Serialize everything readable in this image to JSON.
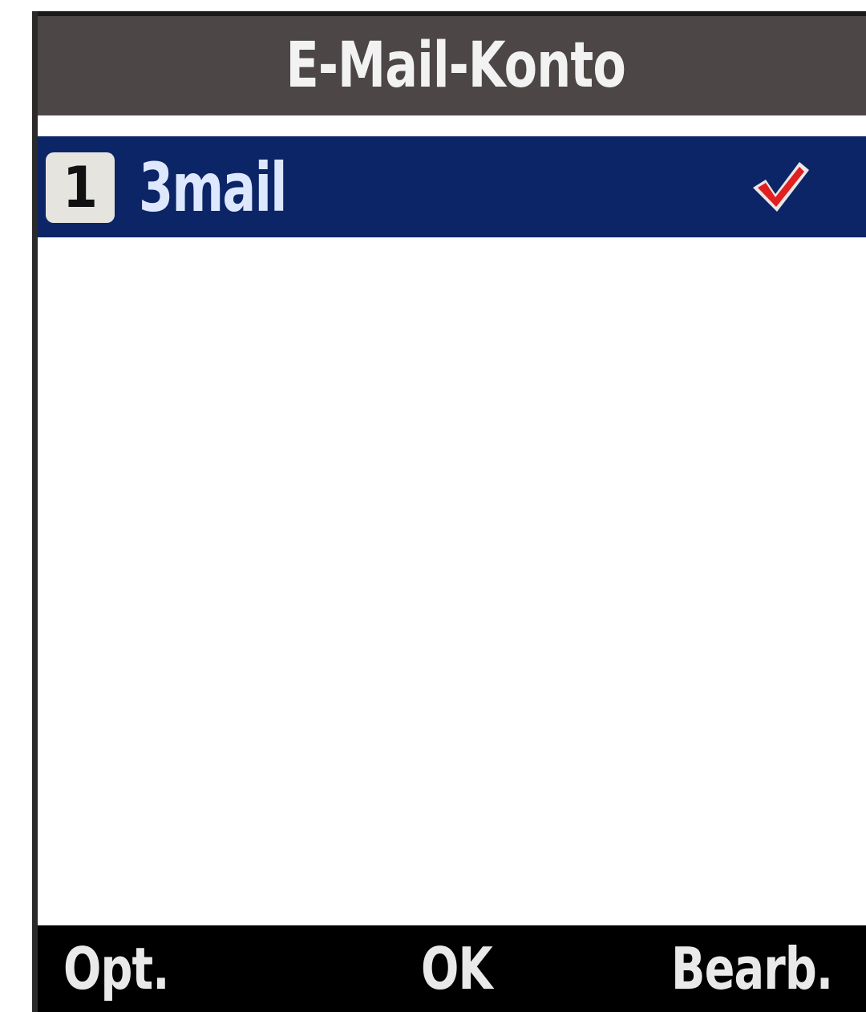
{
  "header": {
    "title": "E-Mail-Konto"
  },
  "accounts": [
    {
      "number": "1",
      "name": "3mail",
      "selected": true,
      "status_icon": "checkmark-icon"
    }
  ],
  "softkeys": {
    "left": "Opt.",
    "center": "OK",
    "right": "Bearb."
  },
  "colors": {
    "title_bar": "#4c4646",
    "selection": "#0c2566",
    "checkmark": "#e02020",
    "softkey_bar": "#000000"
  }
}
